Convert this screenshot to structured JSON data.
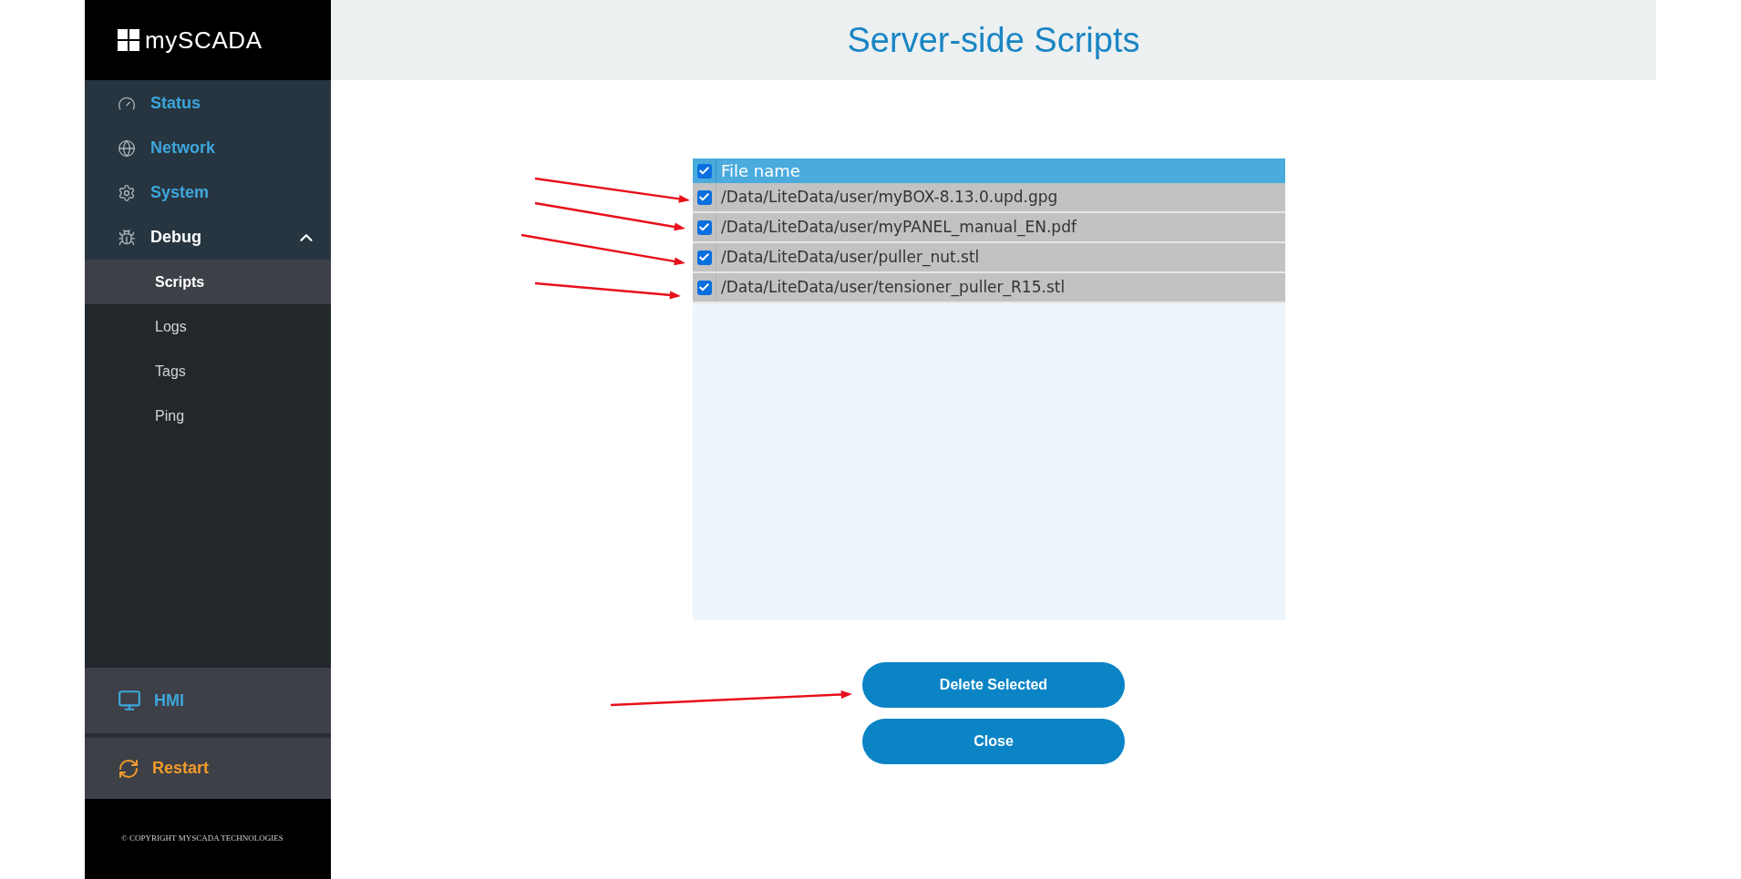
{
  "sidebar": {
    "logo": "mySCADA",
    "items": [
      {
        "label": "Status",
        "kind": "gauge",
        "expanded": false
      },
      {
        "label": "Network",
        "kind": "globe",
        "expanded": false
      },
      {
        "label": "System",
        "kind": "gear",
        "expanded": false
      },
      {
        "label": "Debug",
        "kind": "bug",
        "expanded": true,
        "children": [
          {
            "label": "Scripts",
            "selected": true
          },
          {
            "label": "Logs",
            "selected": false
          },
          {
            "label": "Tags",
            "selected": false
          },
          {
            "label": "Ping",
            "selected": false
          }
        ]
      }
    ],
    "bottom_items": [
      {
        "label": "HMI",
        "kind": "hmi"
      },
      {
        "label": "Restart",
        "kind": "restart"
      }
    ],
    "footer": "© COPYRIGHT MYSCADA TECHNOLOGIES"
  },
  "page": {
    "title": "Server-side Scripts"
  },
  "table": {
    "header": {
      "label": "File name",
      "checked": true
    },
    "rows": [
      {
        "name": "/Data/LiteData/user/myBOX-8.13.0.upd.gpg",
        "checked": true
      },
      {
        "name": "/Data/LiteData/user/myPANEL_manual_EN.pdf",
        "checked": true
      },
      {
        "name": "/Data/LiteData/user/puller_nut.stl",
        "checked": true
      },
      {
        "name": "/Data/LiteData/user/tensioner_puller_R15.stl",
        "checked": true
      }
    ]
  },
  "buttons": [
    "Delete Selected",
    "Close"
  ]
}
